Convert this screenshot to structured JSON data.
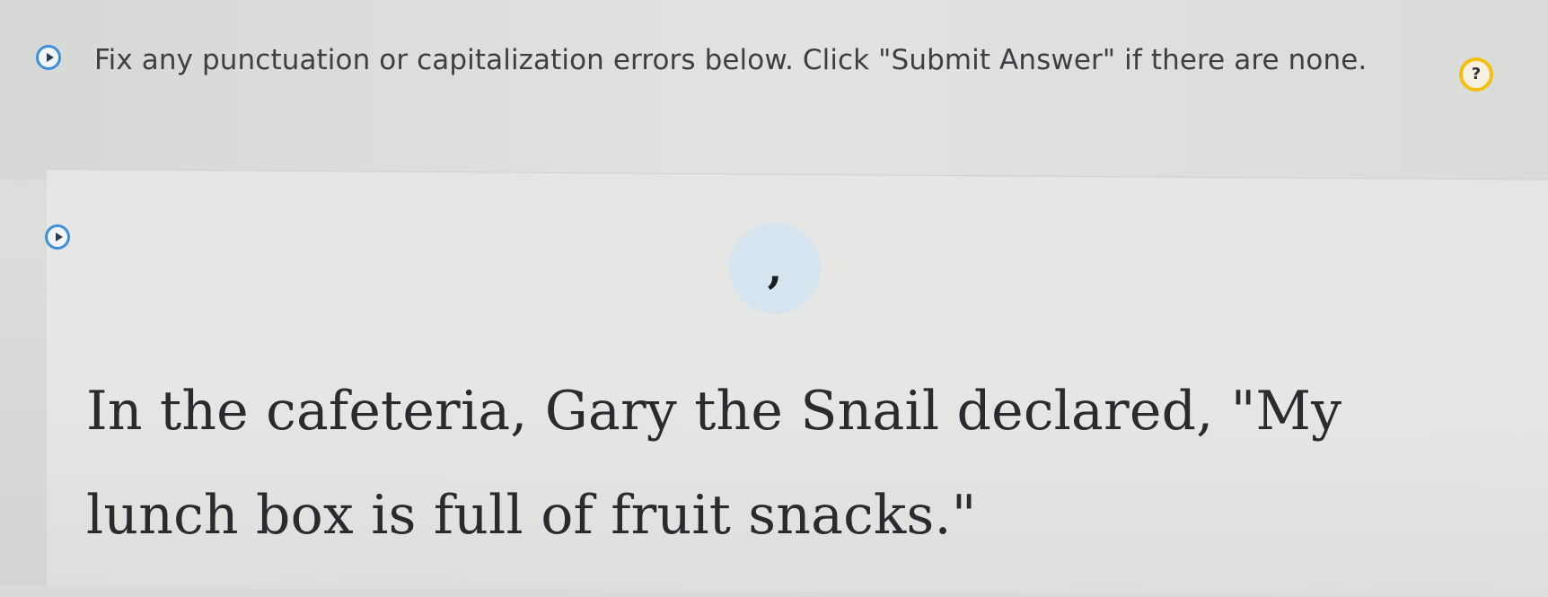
{
  "instruction": {
    "text": "Fix any punctuation or capitalization errors below. Click \"Submit Answer\" if there are none.",
    "help_label": "?"
  },
  "question": {
    "punctuation_chip_label": ",",
    "sentence": "In the cafeteria, Gary the Snail declared, \"My lunch box is full of fruit snacks.\""
  },
  "icons": {
    "play": "play-icon",
    "help": "help-icon"
  },
  "colors": {
    "accent_blue": "#3f8fd7",
    "help_yellow": "#f2bf12",
    "chip_blue": "#d6e4ef"
  }
}
